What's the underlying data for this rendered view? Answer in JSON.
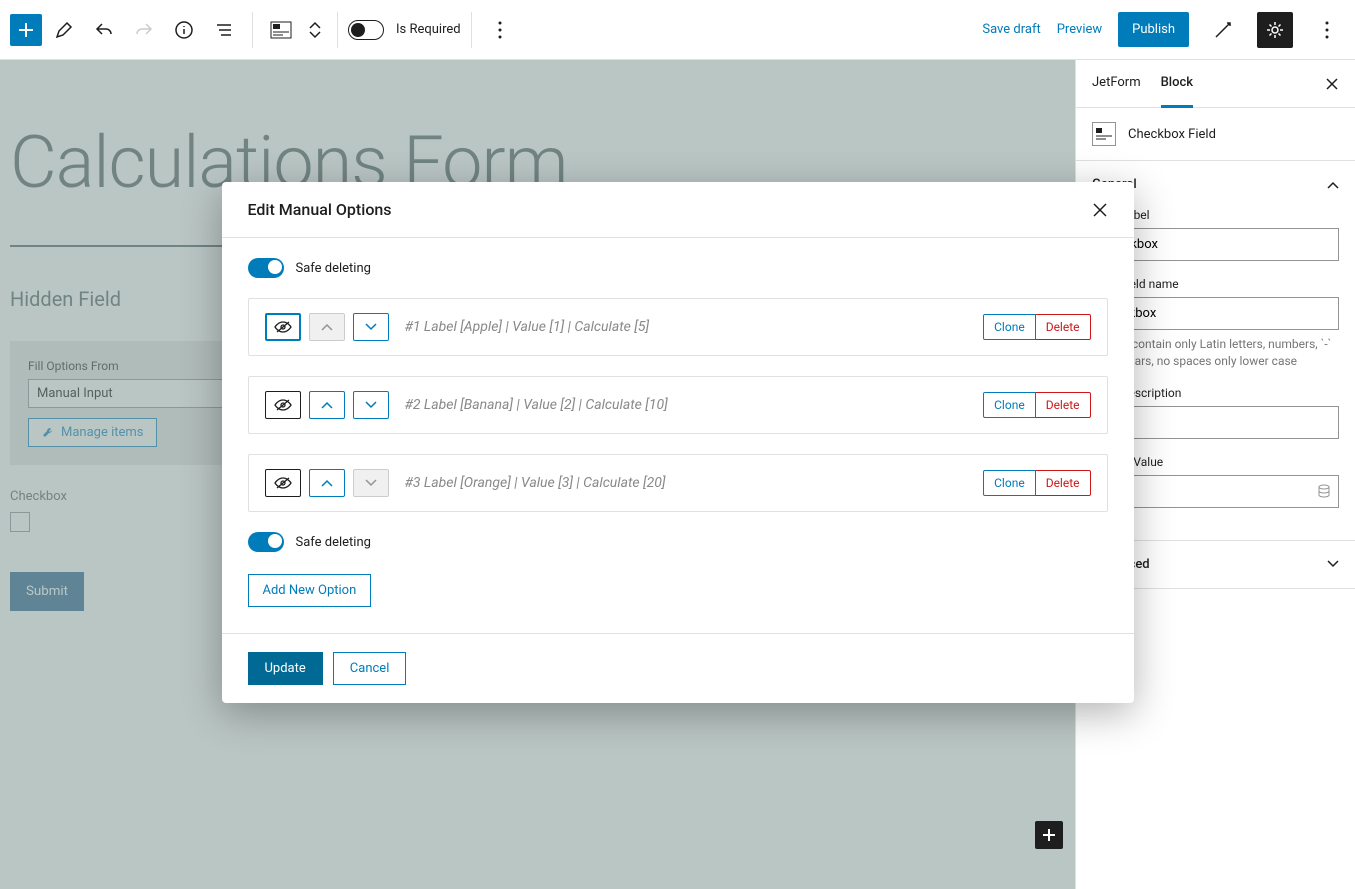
{
  "toolbar": {
    "is_required_label": "Is Required",
    "save_draft": "Save draft",
    "preview": "Preview",
    "publish": "Publish"
  },
  "page": {
    "title": "Calculations Form",
    "hidden_field_label": "Hidden Field",
    "fill_options_label": "Fill Options From",
    "fill_options_value": "Manual Input",
    "manage_items": "Manage items",
    "checkbox_label": "Checkbox",
    "submit": "Submit"
  },
  "sidebar": {
    "tabs": {
      "jetform": "JetForm",
      "block": "Block"
    },
    "block_name": "Checkbox Field",
    "panels": {
      "general": "General",
      "advanced": "Advanced"
    },
    "fields": {
      "field_label_label": "Field Label",
      "field_label_value": "Checkbox",
      "form_field_name_label": "Form field name",
      "form_field_name_value": "checkbox",
      "form_field_name_help": "Should contain only Latin letters, numbers, `-` or `_` chars, no spaces only lower case",
      "field_description_label": "Field Description",
      "field_description_value": "",
      "default_value_label": "Default Value",
      "default_value_value": ""
    }
  },
  "modal": {
    "title": "Edit Manual Options",
    "safe_deleting": "Safe deleting",
    "options": [
      {
        "summary": "#1 Label [Apple] | Value [1] | Calculate [5]",
        "up_disabled": true,
        "down_disabled": false,
        "eye_active": true
      },
      {
        "summary": "#2 Label [Banana] | Value [2] | Calculate [10]",
        "up_disabled": false,
        "down_disabled": false,
        "eye_active": false
      },
      {
        "summary": "#3 Label [Orange] | Value [3] | Calculate [20]",
        "up_disabled": false,
        "down_disabled": true,
        "eye_active": false
      }
    ],
    "clone": "Clone",
    "delete": "Delete",
    "add_new": "Add New Option",
    "update": "Update",
    "cancel": "Cancel"
  }
}
